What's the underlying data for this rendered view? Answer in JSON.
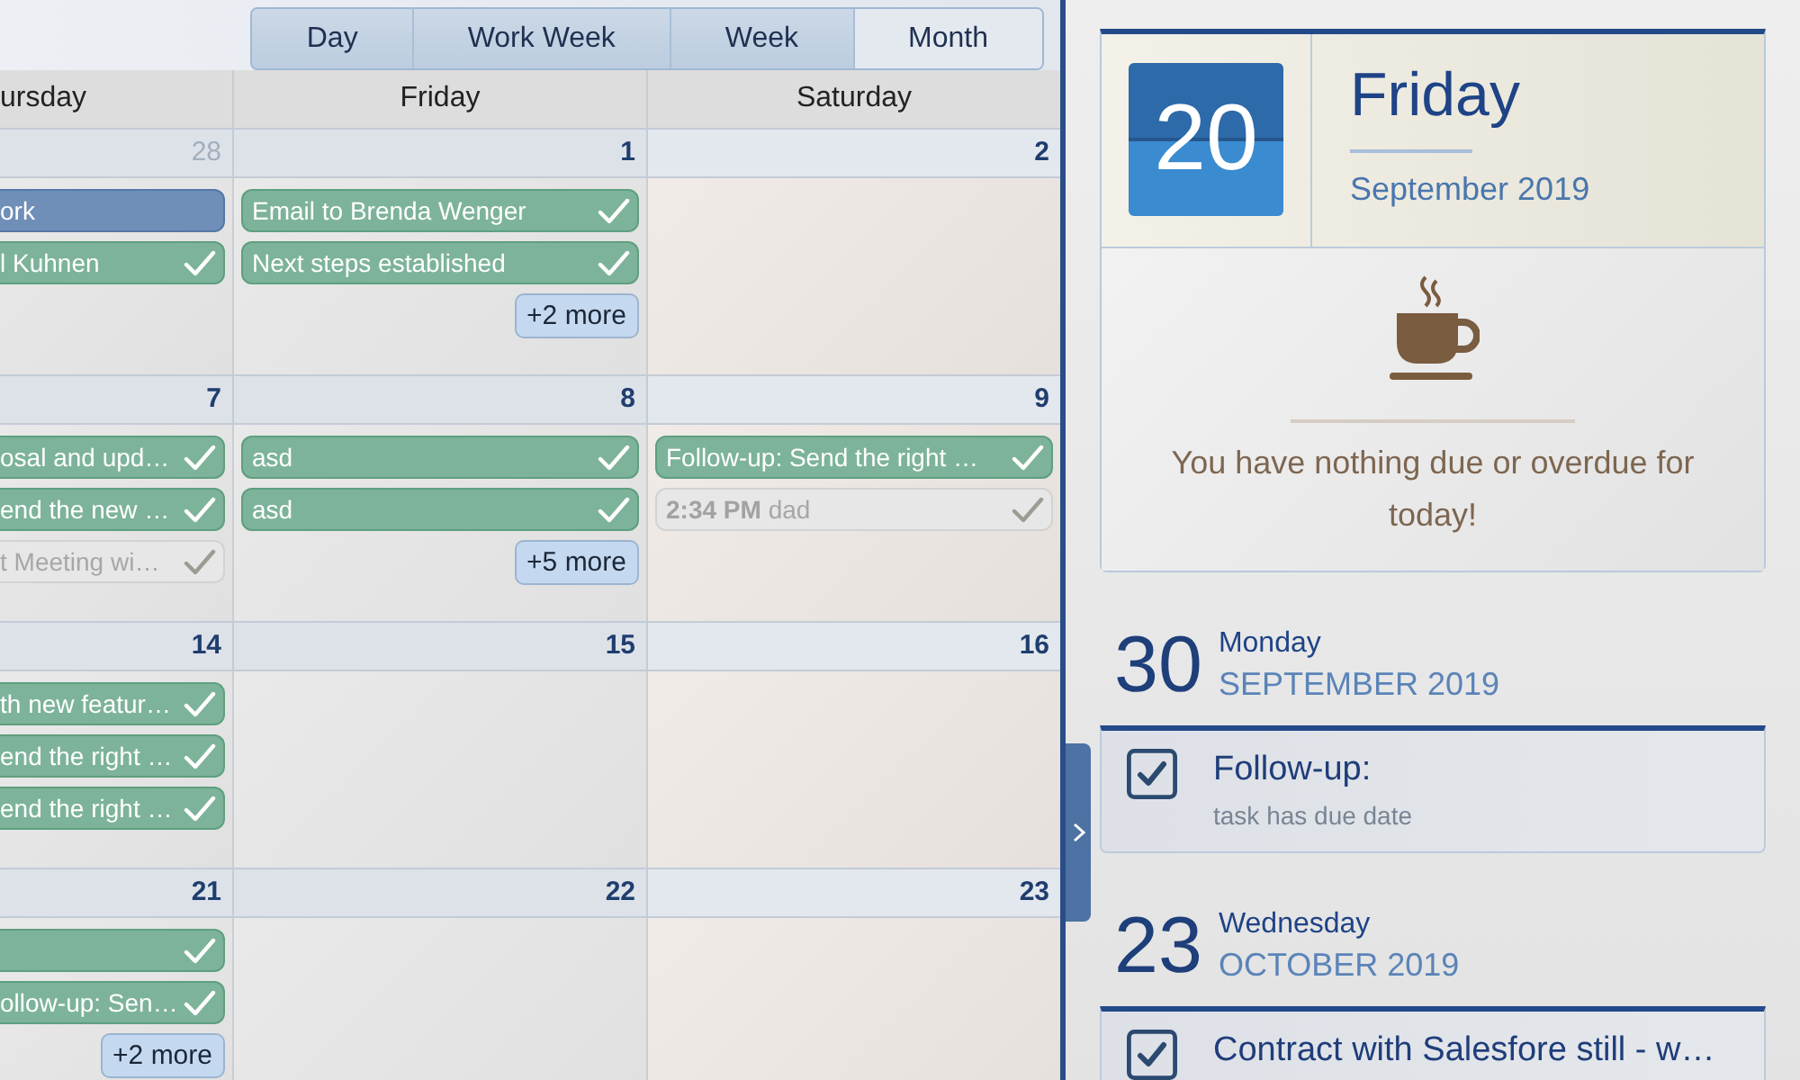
{
  "calendar": {
    "views": [
      {
        "label": "Day",
        "selected": false
      },
      {
        "label": "Work Week",
        "selected": false
      },
      {
        "label": "Week",
        "selected": false
      },
      {
        "label": "Month",
        "selected": true
      }
    ],
    "columns": [
      {
        "label": "ursday",
        "weekend": false
      },
      {
        "label": "Friday",
        "weekend": false
      },
      {
        "label": "Saturday",
        "weekend": true
      }
    ],
    "weeks": [
      {
        "days": [
          {
            "date": "28",
            "other_month": true,
            "events": [
              {
                "kind": "appointment",
                "title": "ork"
              },
              {
                "kind": "task",
                "title": "l Kuhnen"
              }
            ]
          },
          {
            "date": "1",
            "other_month": false,
            "events": [
              {
                "kind": "task",
                "title": "Email to Brenda Wenger"
              },
              {
                "kind": "task",
                "title": "Next steps established"
              }
            ],
            "more": "+2 more"
          },
          {
            "date": "2",
            "other_month": false
          }
        ]
      },
      {
        "days": [
          {
            "date": "7",
            "other_month": false,
            "events": [
              {
                "kind": "task",
                "title": "osal and upd…"
              },
              {
                "kind": "task",
                "title": "end the new …"
              },
              {
                "kind": "muted",
                "title": "t Meeting wi…"
              }
            ]
          },
          {
            "date": "8",
            "other_month": false,
            "events": [
              {
                "kind": "task",
                "title": "asd"
              },
              {
                "kind": "task",
                "title": "asd"
              }
            ],
            "more": "+5 more"
          },
          {
            "date": "9",
            "other_month": false,
            "events": [
              {
                "kind": "task",
                "title": "Follow-up: Send the right …"
              },
              {
                "kind": "muted",
                "time": "2:34 PM",
                "title": "dad"
              }
            ]
          }
        ]
      },
      {
        "days": [
          {
            "date": "14",
            "other_month": false,
            "events": [
              {
                "kind": "task",
                "title": "th new featur…"
              },
              {
                "kind": "task",
                "title": "end the right …"
              },
              {
                "kind": "task",
                "title": "end the right …"
              }
            ]
          },
          {
            "date": "15",
            "other_month": false
          },
          {
            "date": "16",
            "other_month": false
          }
        ]
      },
      {
        "days": [
          {
            "date": "21",
            "other_month": false,
            "events": [
              {
                "kind": "task"
              },
              {
                "kind": "task",
                "title": "ollow-up: Sen…"
              }
            ],
            "more": "+2 more"
          },
          {
            "date": "22",
            "other_month": false
          },
          {
            "date": "23",
            "other_month": false
          }
        ]
      }
    ]
  },
  "side_panel": {
    "today": {
      "day_number": "20",
      "weekday": "Friday",
      "month_year": "September 2019",
      "message": "You have nothing due or overdue for today!"
    },
    "agenda": [
      {
        "day_number": "30",
        "weekday": "Monday",
        "month_year": "SEPTEMBER 2019",
        "tasks": [
          {
            "title": "Follow-up:",
            "detail": "task has due date",
            "checked": true
          }
        ]
      },
      {
        "day_number": "23",
        "weekday": "Wednesday",
        "month_year": "OCTOBER 2019",
        "tasks": [
          {
            "title": "Contract with Salesfore still - w…",
            "checked": true
          }
        ]
      }
    ]
  }
}
